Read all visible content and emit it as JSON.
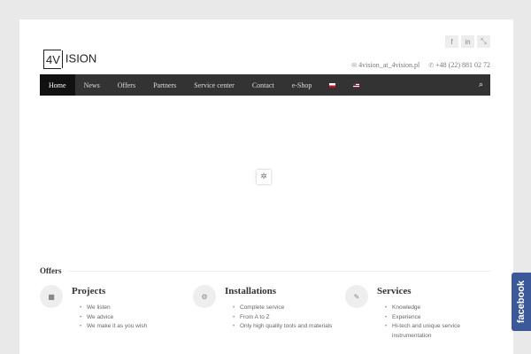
{
  "logo": {
    "box": "4V",
    "rest": "ISION"
  },
  "social": [
    {
      "icon": "facebook-icon",
      "glyph": "f"
    },
    {
      "icon": "linkedin-icon",
      "glyph": "in"
    },
    {
      "icon": "share-icon",
      "glyph": "⤡"
    }
  ],
  "contact": {
    "email": "4vision_at_4vision.pl",
    "phone": "+48 (22) 881 02 72"
  },
  "nav": {
    "items": [
      "Home",
      "News",
      "Offers",
      "Partners",
      "Service center",
      "Contact",
      "e-Shop"
    ],
    "active": "Home"
  },
  "spinner_glyph": "✲",
  "offers": {
    "title": "Offers",
    "columns": [
      {
        "icon": "video-camera-icon",
        "glyph": "■",
        "title": "Projects",
        "items": [
          "We listen",
          "We advice",
          "We make it as you wish"
        ]
      },
      {
        "icon": "gears-icon",
        "glyph": "⚙",
        "title": "Installations",
        "items": [
          "Complete service",
          "From A to Z",
          "Only high quality tools and materials"
        ]
      },
      {
        "icon": "wrench-icon",
        "glyph": "✎",
        "title": "Services",
        "items": [
          "Knowledge",
          "Experience",
          "Hi-tech and unique service instrumentation"
        ]
      }
    ]
  },
  "facebook_tab": "facebook"
}
